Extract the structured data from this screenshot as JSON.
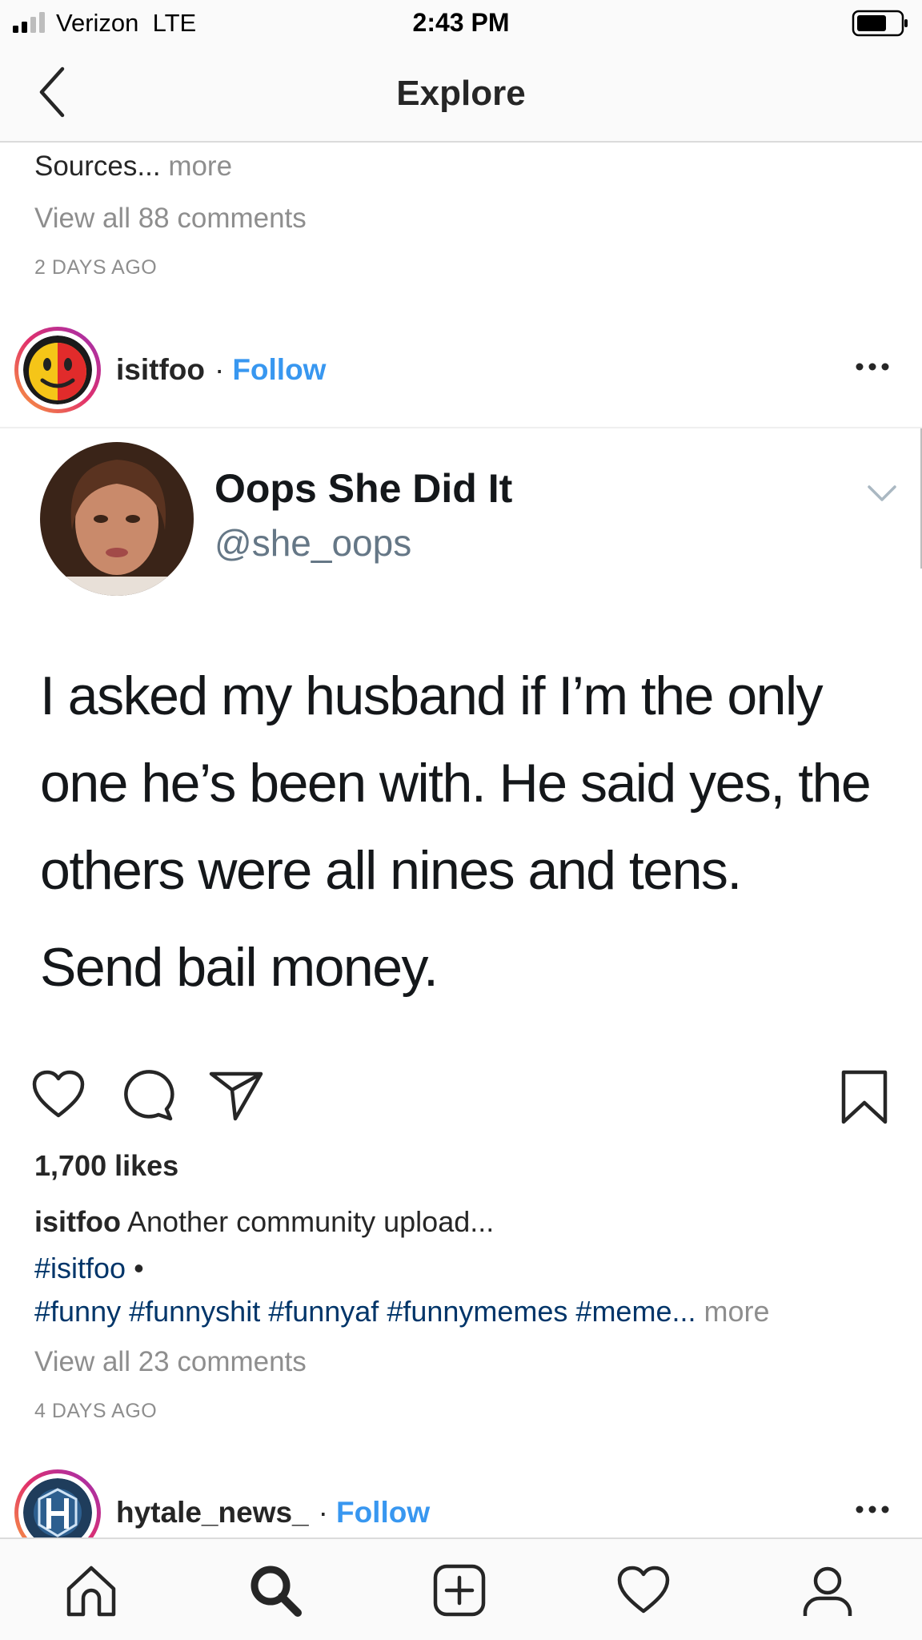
{
  "status_bar": {
    "carrier": "Verizon",
    "network": "LTE",
    "time": "2:43 PM"
  },
  "nav": {
    "title": "Explore"
  },
  "previous_post": {
    "caption": "Sources...",
    "more": "more",
    "view_comments": "View all 88 comments",
    "timestamp": "2 DAYS AGO"
  },
  "post": {
    "username": "isitfoo",
    "separator": "·",
    "follow": "Follow",
    "tweet": {
      "name": "Oops She Did It",
      "handle": "@she_oops",
      "text": "I asked my husband if I’m the only one he’s been with. He said yes, the others were all nines and tens.",
      "text2": "Send bail money."
    },
    "likes": "1,700 likes",
    "caption_user": "isitfoo",
    "caption_text": "Another community upload...",
    "hashtag_line1": "#isitfoo",
    "bullet": "•",
    "hashtag_line2": "#funny #funnyshit #funnyaf #funnymemes #meme...",
    "more": "more",
    "view_comments": "View all 23 comments",
    "timestamp": "4 DAYS AGO"
  },
  "next_post": {
    "username": "hytale_news_",
    "separator": "·",
    "follow": "Follow"
  },
  "tab_bar": {
    "items": [
      {
        "icon": "home-icon"
      },
      {
        "icon": "search-icon",
        "active": true
      },
      {
        "icon": "add-post-icon"
      },
      {
        "icon": "activity-heart-icon"
      },
      {
        "icon": "profile-icon"
      }
    ]
  },
  "colors": {
    "link": "#3897f0",
    "hashtag": "#003569",
    "muted": "#8e8e8e",
    "text": "#262626"
  }
}
